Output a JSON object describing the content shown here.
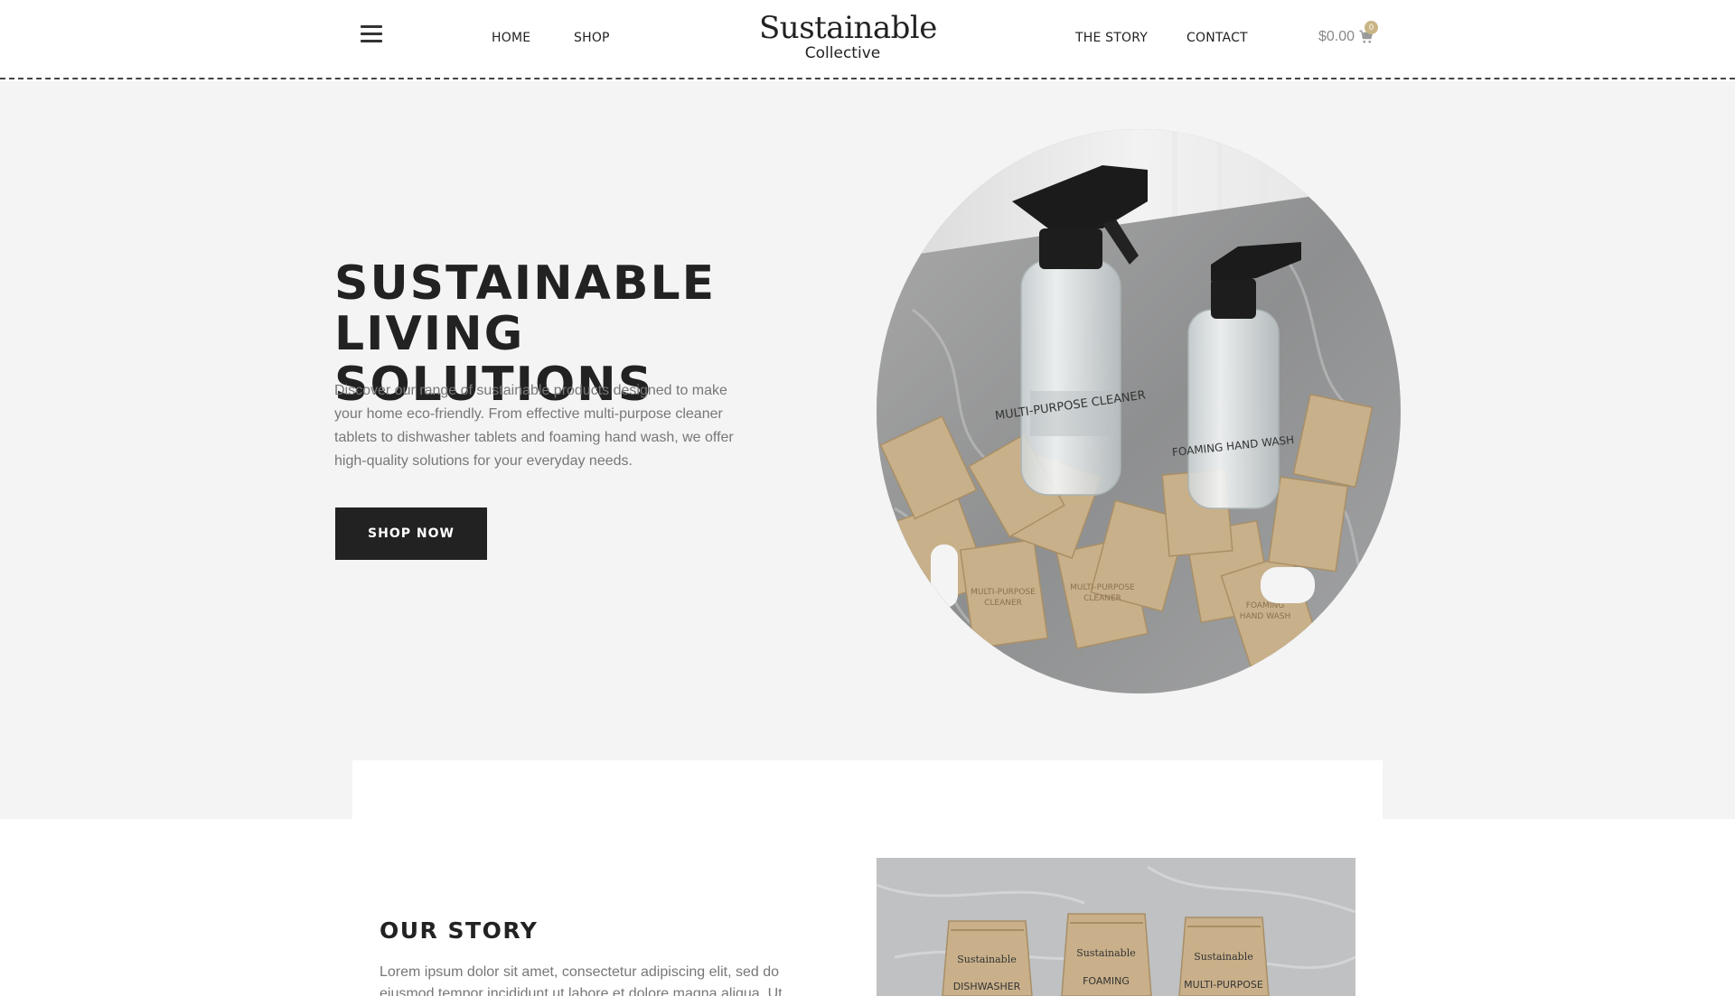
{
  "header": {
    "nav_left": [
      {
        "label": "HOME"
      },
      {
        "label": "SHOP"
      }
    ],
    "logo": {
      "main": "Sustainable",
      "sub": "Collective"
    },
    "nav_right": [
      {
        "label": "THE STORY"
      },
      {
        "label": "CONTACT"
      }
    ],
    "cart": {
      "price": "$0.00",
      "count": "0"
    },
    "icons": {
      "menu": "hamburger-menu-icon",
      "cart": "shopping-cart-icon"
    }
  },
  "hero": {
    "title_line1": "SUSTAINABLE LIVING",
    "title_line2": "SOLUTIONS",
    "description": "Discover our range of sustainable products designed to make your home eco-friendly. From effective multi-purpose cleaner tablets to dishwasher tablets and foaming hand wash, we offer high-quality solutions for your everyday needs.",
    "button_label": "SHOP NOW",
    "image_labels": {
      "bottle_left": "MULTI-PURPOSE CLEANER",
      "bottle_right": "FOAMING HAND WASH"
    }
  },
  "story": {
    "title": "OUR STORY",
    "text": "Lorem ipsum dolor sit amet, consectetur adipiscing elit, sed do eiusmod tempor incididunt ut labore et dolore magna aliqua. Ut",
    "image_labels": {
      "pack1_brand": "Sustainable",
      "pack1_name": "DISHWASHER",
      "pack2_brand": "Sustainable",
      "pack2_name": "FOAMING",
      "pack3_brand": "Sustainable",
      "pack3_name": "MULTI-PURPOSE"
    }
  },
  "colors": {
    "hero_bg": "#f4f4f4",
    "button_bg": "#222222",
    "badge": "#c9b585",
    "text_muted": "#777777"
  }
}
